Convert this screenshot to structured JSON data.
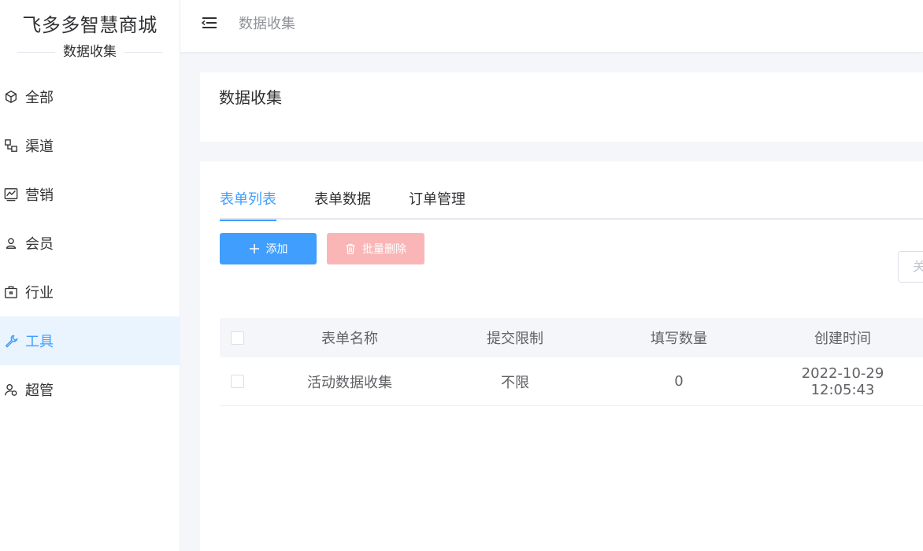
{
  "sidebar": {
    "brand_title": "飞多多智慧商城",
    "brand_subtitle": "数据收集",
    "items": [
      {
        "label": "全部",
        "icon": "cube-icon"
      },
      {
        "label": "渠道",
        "icon": "channel-icon"
      },
      {
        "label": "营销",
        "icon": "chart-icon"
      },
      {
        "label": "会员",
        "icon": "user-icon"
      },
      {
        "label": "行业",
        "icon": "briefcase-icon"
      },
      {
        "label": "工具",
        "icon": "wrench-icon",
        "active": true
      },
      {
        "label": "超管",
        "icon": "admin-icon"
      }
    ]
  },
  "header": {
    "breadcrumb": "数据收集"
  },
  "page": {
    "title": "数据收集"
  },
  "tabs": [
    {
      "label": "表单列表",
      "active": true
    },
    {
      "label": "表单数据"
    },
    {
      "label": "订单管理"
    }
  ],
  "toolbar": {
    "add_label": "添加",
    "batch_delete_label": "批量删除",
    "search_partial": "关"
  },
  "table": {
    "columns": [
      "表单名称",
      "提交限制",
      "填写数量",
      "创建时间"
    ],
    "rows": [
      {
        "name": "活动数据收集",
        "limit": "不限",
        "count": "0",
        "created": "2022-10-29 12:05:43"
      }
    ]
  },
  "colors": {
    "accent": "#409eff",
    "danger_disabled": "#fab6b6",
    "active_menu_bg": "#e9f4fe"
  }
}
